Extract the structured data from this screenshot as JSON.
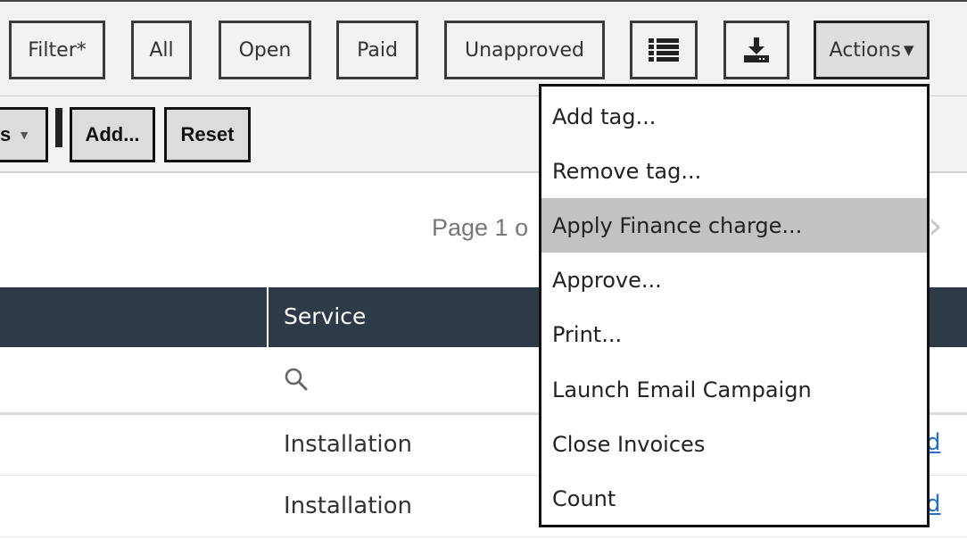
{
  "toolbar": {
    "buttons": {
      "filter": "Filter*",
      "all": "All",
      "open": "Open",
      "paid": "Paid",
      "unapproved": "Unapproved",
      "list_icon": "list-icon",
      "download_icon": "download-icon",
      "actions": "Actions"
    },
    "caret": "▼"
  },
  "secondbar": {
    "partial_label": "s",
    "add_label": "Add...",
    "reset_label": "Reset",
    "caret": "▼"
  },
  "pager": {
    "text": "Page 1 o",
    "next": "›"
  },
  "table": {
    "header": "Service",
    "search_icon": "search-icon",
    "rows": [
      {
        "service": "Installation",
        "link": "d"
      },
      {
        "service": "Installation",
        "link": "d"
      }
    ]
  },
  "actions_menu": {
    "items": [
      "Add tag...",
      "Remove tag...",
      "Apply Finance charge...",
      "Approve...",
      "Print...",
      "Launch Email Campaign",
      "Close Invoices",
      "Count"
    ],
    "highlighted": "Apply Finance charge..."
  },
  "colors": {
    "header_bg": "#2e3a48",
    "highlight": "#c2c2c2",
    "link": "#2a6fc9"
  }
}
